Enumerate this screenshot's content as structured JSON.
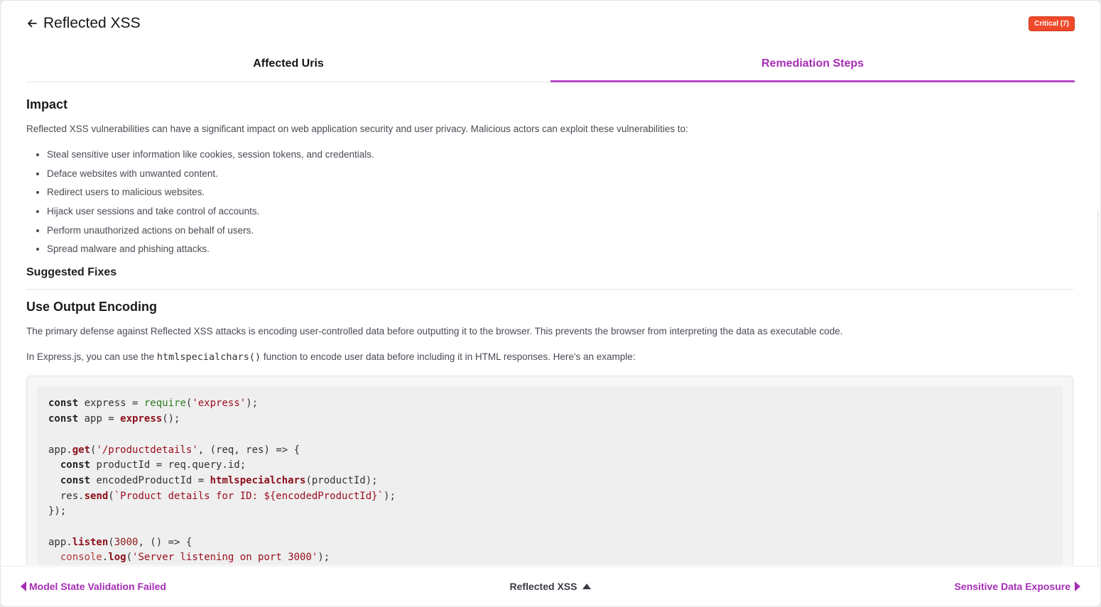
{
  "header": {
    "title": "Reflected XSS",
    "back_icon": "arrow-left-icon",
    "badge": "Critical (7)",
    "badge_color": "#ef4a2b"
  },
  "tabs": [
    {
      "label": "Affected Uris",
      "active": false
    },
    {
      "label": "Remediation Steps",
      "active": true
    }
  ],
  "accent_color": "#a62db6",
  "impact": {
    "heading": "Impact",
    "intro": "Reflected XSS vulnerabilities can have a significant impact on web application security and user privacy. Malicious actors can exploit these vulnerabilities to:",
    "items": [
      "Steal sensitive user information like cookies, session tokens, and credentials.",
      "Deface websites with unwanted content.",
      "Redirect users to malicious websites.",
      "Hijack user sessions and take control of accounts.",
      "Perform unauthorized actions on behalf of users.",
      "Spread malware and phishing attacks."
    ]
  },
  "fixes": {
    "heading": "Suggested Fixes",
    "sub_heading": "Use Output Encoding",
    "para1": "The primary defense against Reflected XSS attacks is encoding user-controlled data before outputting it to the browser. This prevents the browser from interpreting the data as executable code.",
    "para2_before": "In Express.js, you can use the ",
    "para2_code": "htmlspecialchars()",
    "para2_after": " function to encode user data before including it in HTML responses. Here's an example:"
  },
  "code_lines": [
    "const express = require('express');",
    "const app = express();",
    "",
    "app.get('/productdetails', (req, res) => {",
    "  const productId = req.query.id;",
    "  const encodedProductId = htmlspecialchars(productId);",
    "  res.send(`Product details for ID: ${encodedProductId}`);",
    "});",
    "",
    "app.listen(3000, () => {",
    "  console.log('Server listening on port 3000');"
  ],
  "footer": {
    "prev_label": "Model State Validation Failed",
    "current_label": "Reflected XSS",
    "next_label": "Sensitive Data Exposure",
    "prev_icon": "caret-left-icon",
    "next_icon": "caret-right-icon",
    "current_icon": "caret-up-icon"
  }
}
